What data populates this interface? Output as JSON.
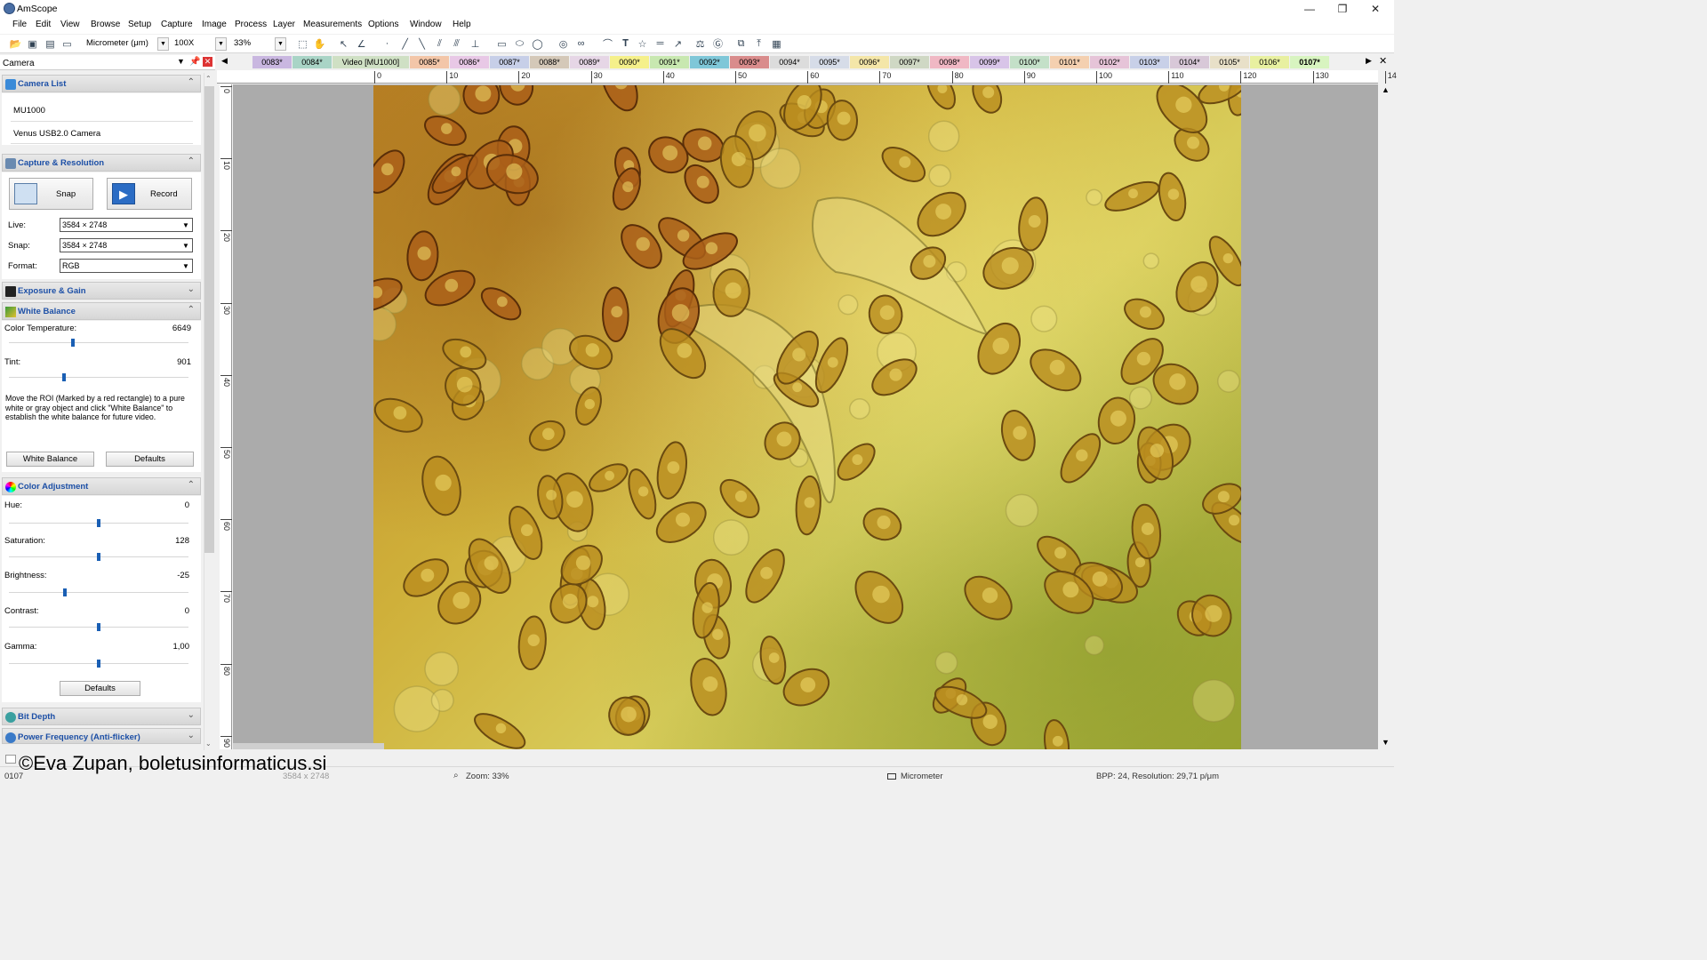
{
  "app": {
    "title": "AmScope"
  },
  "menu": [
    "File",
    "Edit",
    "View",
    "Browse",
    "Setup",
    "Capture",
    "Image",
    "Process",
    "Layer",
    "Measurements",
    "Options",
    "Window",
    "Help"
  ],
  "toolbar": {
    "unit": "Micrometer (μm)",
    "magnification": "100X",
    "zoom": "33%"
  },
  "panel": {
    "title": "Camera",
    "camera_list": {
      "title": "Camera List",
      "items": [
        "MU1000",
        "Venus USB2.0 Camera"
      ]
    },
    "capture": {
      "title": "Capture & Resolution",
      "snap_label": "Snap",
      "record_label": "Record",
      "live_label": "Live:",
      "live_value": "3584 × 2748",
      "snap_res_label": "Snap:",
      "snap_res_value": "3584 × 2748",
      "format_label": "Format:",
      "format_value": "RGB"
    },
    "exposure": {
      "title": "Exposure & Gain"
    },
    "white_balance": {
      "title": "White Balance",
      "color_temp_label": "Color Temperature:",
      "color_temp_value": "6649",
      "tint_label": "Tint:",
      "tint_value": "901",
      "help": "Move the ROI (Marked by a red rectangle) to a pure white or gray object and click \"White Balance\" to establish the white balance for future video.",
      "wb_button": "White Balance",
      "defaults_button": "Defaults"
    },
    "color_adjustment": {
      "title": "Color Adjustment",
      "hue_label": "Hue:",
      "hue_value": "0",
      "saturation_label": "Saturation:",
      "saturation_value": "128",
      "brightness_label": "Brightness:",
      "brightness_value": "-25",
      "contrast_label": "Contrast:",
      "contrast_value": "0",
      "gamma_label": "Gamma:",
      "gamma_value": "1,00",
      "defaults_button": "Defaults"
    },
    "bit_depth": {
      "title": "Bit Depth"
    },
    "power_freq": {
      "title": "Power Frequency (Anti-flicker)"
    }
  },
  "tabs": [
    {
      "label": "0083*",
      "color": "#c9b7e0"
    },
    {
      "label": "0084*",
      "color": "#a9d4c6"
    },
    {
      "label": "Video [MU1000]",
      "color": "#cfe0c4"
    },
    {
      "label": "0085*",
      "color": "#f3c6a8"
    },
    {
      "label": "0086*",
      "color": "#e8c8e6"
    },
    {
      "label": "0087*",
      "color": "#c7cfe8"
    },
    {
      "label": "0088*",
      "color": "#d4c8b8"
    },
    {
      "label": "0089*",
      "color": "#e6d6e6"
    },
    {
      "label": "0090*",
      "color": "#f5f08a"
    },
    {
      "label": "0091*",
      "color": "#c8e8b0"
    },
    {
      "label": "0092*",
      "color": "#7fc7d8"
    },
    {
      "label": "0093*",
      "color": "#d98c8c"
    },
    {
      "label": "0094*",
      "color": "#dcdcdc"
    },
    {
      "label": "0095*",
      "color": "#d6dce8"
    },
    {
      "label": "0096*",
      "color": "#f4e6a8"
    },
    {
      "label": "0097*",
      "color": "#cfd8c4"
    },
    {
      "label": "0098*",
      "color": "#f0b8c4"
    },
    {
      "label": "0099*",
      "color": "#d8c4e8"
    },
    {
      "label": "0100*",
      "color": "#c4e0c8"
    },
    {
      "label": "0101*",
      "color": "#f4d0b0"
    },
    {
      "label": "0102*",
      "color": "#e6c4d8"
    },
    {
      "label": "0103*",
      "color": "#c8d0e8"
    },
    {
      "label": "0104*",
      "color": "#d8c8d8"
    },
    {
      "label": "0105*",
      "color": "#e8e0c8"
    },
    {
      "label": "0106*",
      "color": "#e8f0a0"
    },
    {
      "label": "0107*",
      "color": "#d8f4c0"
    }
  ],
  "ruler": {
    "h": [
      "0",
      "10",
      "20",
      "30",
      "40",
      "50",
      "60",
      "70",
      "80",
      "90",
      "100",
      "110",
      "120",
      "130",
      "14"
    ],
    "v": [
      "0",
      "10",
      "20",
      "30",
      "40",
      "50",
      "60",
      "70",
      "80",
      "90"
    ]
  },
  "status": {
    "doc": "0107",
    "size": "3584 x 2748",
    "zoom": "Zoom: 33%",
    "unit": "Micrometer",
    "info": "BPP: 24, Resolution: 29,71 p/μm"
  },
  "watermark": "©Eva Zupan, boletusinformaticus.si",
  "colors": {
    "accent": "#1a5fb4",
    "section_title": "#1c4fa6"
  }
}
